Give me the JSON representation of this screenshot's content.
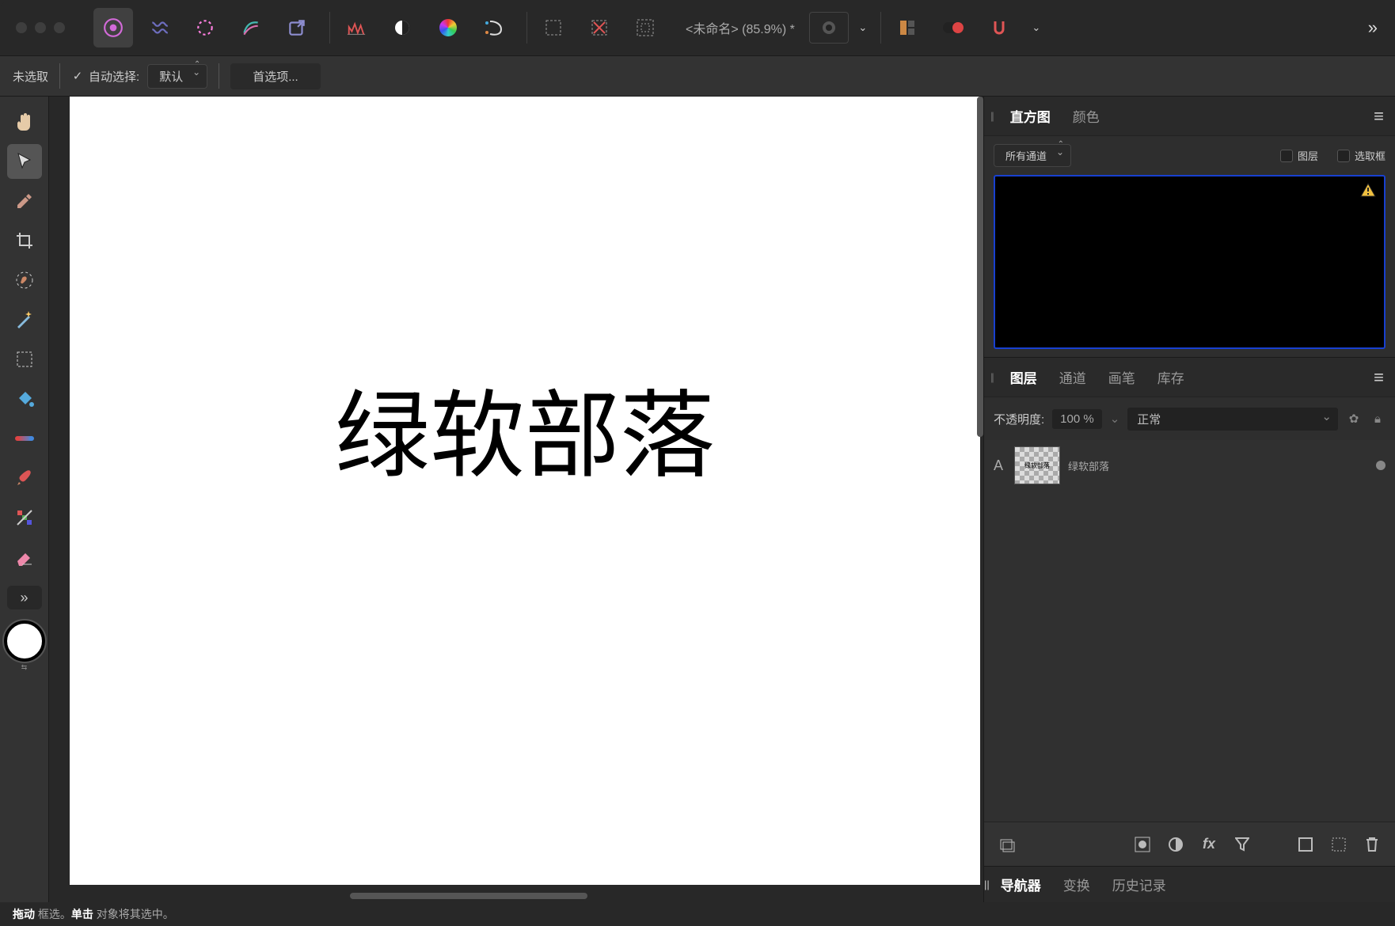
{
  "top": {
    "doc_title": "<未命名> (85.9%)  *",
    "overflow": "»"
  },
  "ctx": {
    "no_selection": "未选取",
    "auto_select": "自动选择:",
    "mode": "默认",
    "prefs": "首选项..."
  },
  "canvas": {
    "text": "绿软部落"
  },
  "panels": {
    "histo": {
      "tab": "直方图",
      "color_tab": "颜色",
      "channel": "所有通道",
      "layer_ck": "图层",
      "marquee_ck": "选取框"
    },
    "layers": {
      "tab": "图层",
      "channels": "通道",
      "brushes": "画笔",
      "stock": "库存",
      "opacity_label": "不透明度:",
      "opacity": "100 %",
      "blend": "正常",
      "layer_name": "绿软部落",
      "thumb_text": "绿软部落"
    },
    "nav": {
      "navigator": "导航器",
      "transform": "变换",
      "history": "历史记录"
    }
  },
  "status": {
    "drag": "拖动",
    "drag_t": " 框选。",
    "click": "单击",
    "click_t": " 对象将其选中。"
  }
}
